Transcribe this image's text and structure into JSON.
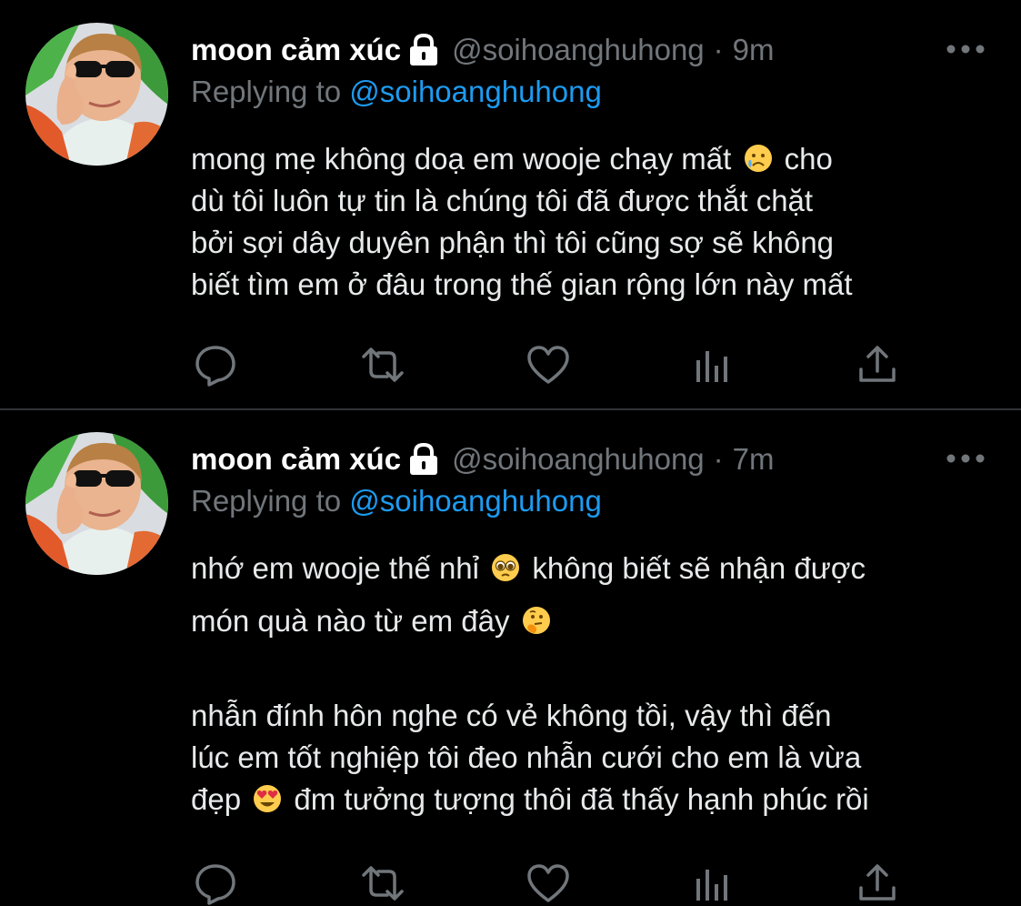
{
  "tweets": [
    {
      "display_name": "moon cảm xúc",
      "lock_icon": "lock-icon",
      "handle": "@soihoanghuhong",
      "separator": "·",
      "time": "9m",
      "replying_prefix": "Replying to ",
      "replying_to": "@soihoanghuhong",
      "lines": [
        {
          "before": "mong mẹ không doạ em wooje chạy mất ",
          "emoji": "sad-tear-emoji",
          "after": " cho"
        },
        {
          "before": "dù tôi luôn tự tin là chúng tôi đã được thắt chặt"
        },
        {
          "before": "bởi sợi dây duyên phận thì tôi cũng sợ sẽ không"
        },
        {
          "before": "biết tìm em ở đâu trong thế gian rộng lớn này mất"
        }
      ]
    },
    {
      "display_name": "moon cảm xúc",
      "lock_icon": "lock-icon",
      "handle": "@soihoanghuhong",
      "separator": "·",
      "time": "7m",
      "replying_prefix": "Replying to ",
      "replying_to": "@soihoanghuhong",
      "lines": [
        {
          "before": "nhớ em wooje thế nhỉ ",
          "emoji": "pleading-face-emoji",
          "after": " không biết sẽ nhận được"
        },
        {
          "before": "món quà nào từ em đây ",
          "emoji": "thinking-face-emoji"
        },
        {
          "before": ""
        },
        {
          "before": "nhẫn đính hôn nghe có vẻ không tồi, vậy thì đến"
        },
        {
          "before": "lúc em tốt nghiệp tôi đeo nhẫn cưới cho em là vừa"
        },
        {
          "before": "đẹp ",
          "emoji": "heart-eyes-emoji",
          "after": " đm tưởng tượng thôi đã thấy hạnh phúc rồi"
        }
      ]
    }
  ],
  "action_icons": [
    "reply-icon",
    "retweet-icon",
    "like-icon",
    "analytics-icon",
    "share-icon"
  ],
  "colors": {
    "background": "#000000",
    "text": "#e7e9ea",
    "secondary": "#71767b",
    "link": "#1d9bf0",
    "divider": "#2f3336"
  }
}
